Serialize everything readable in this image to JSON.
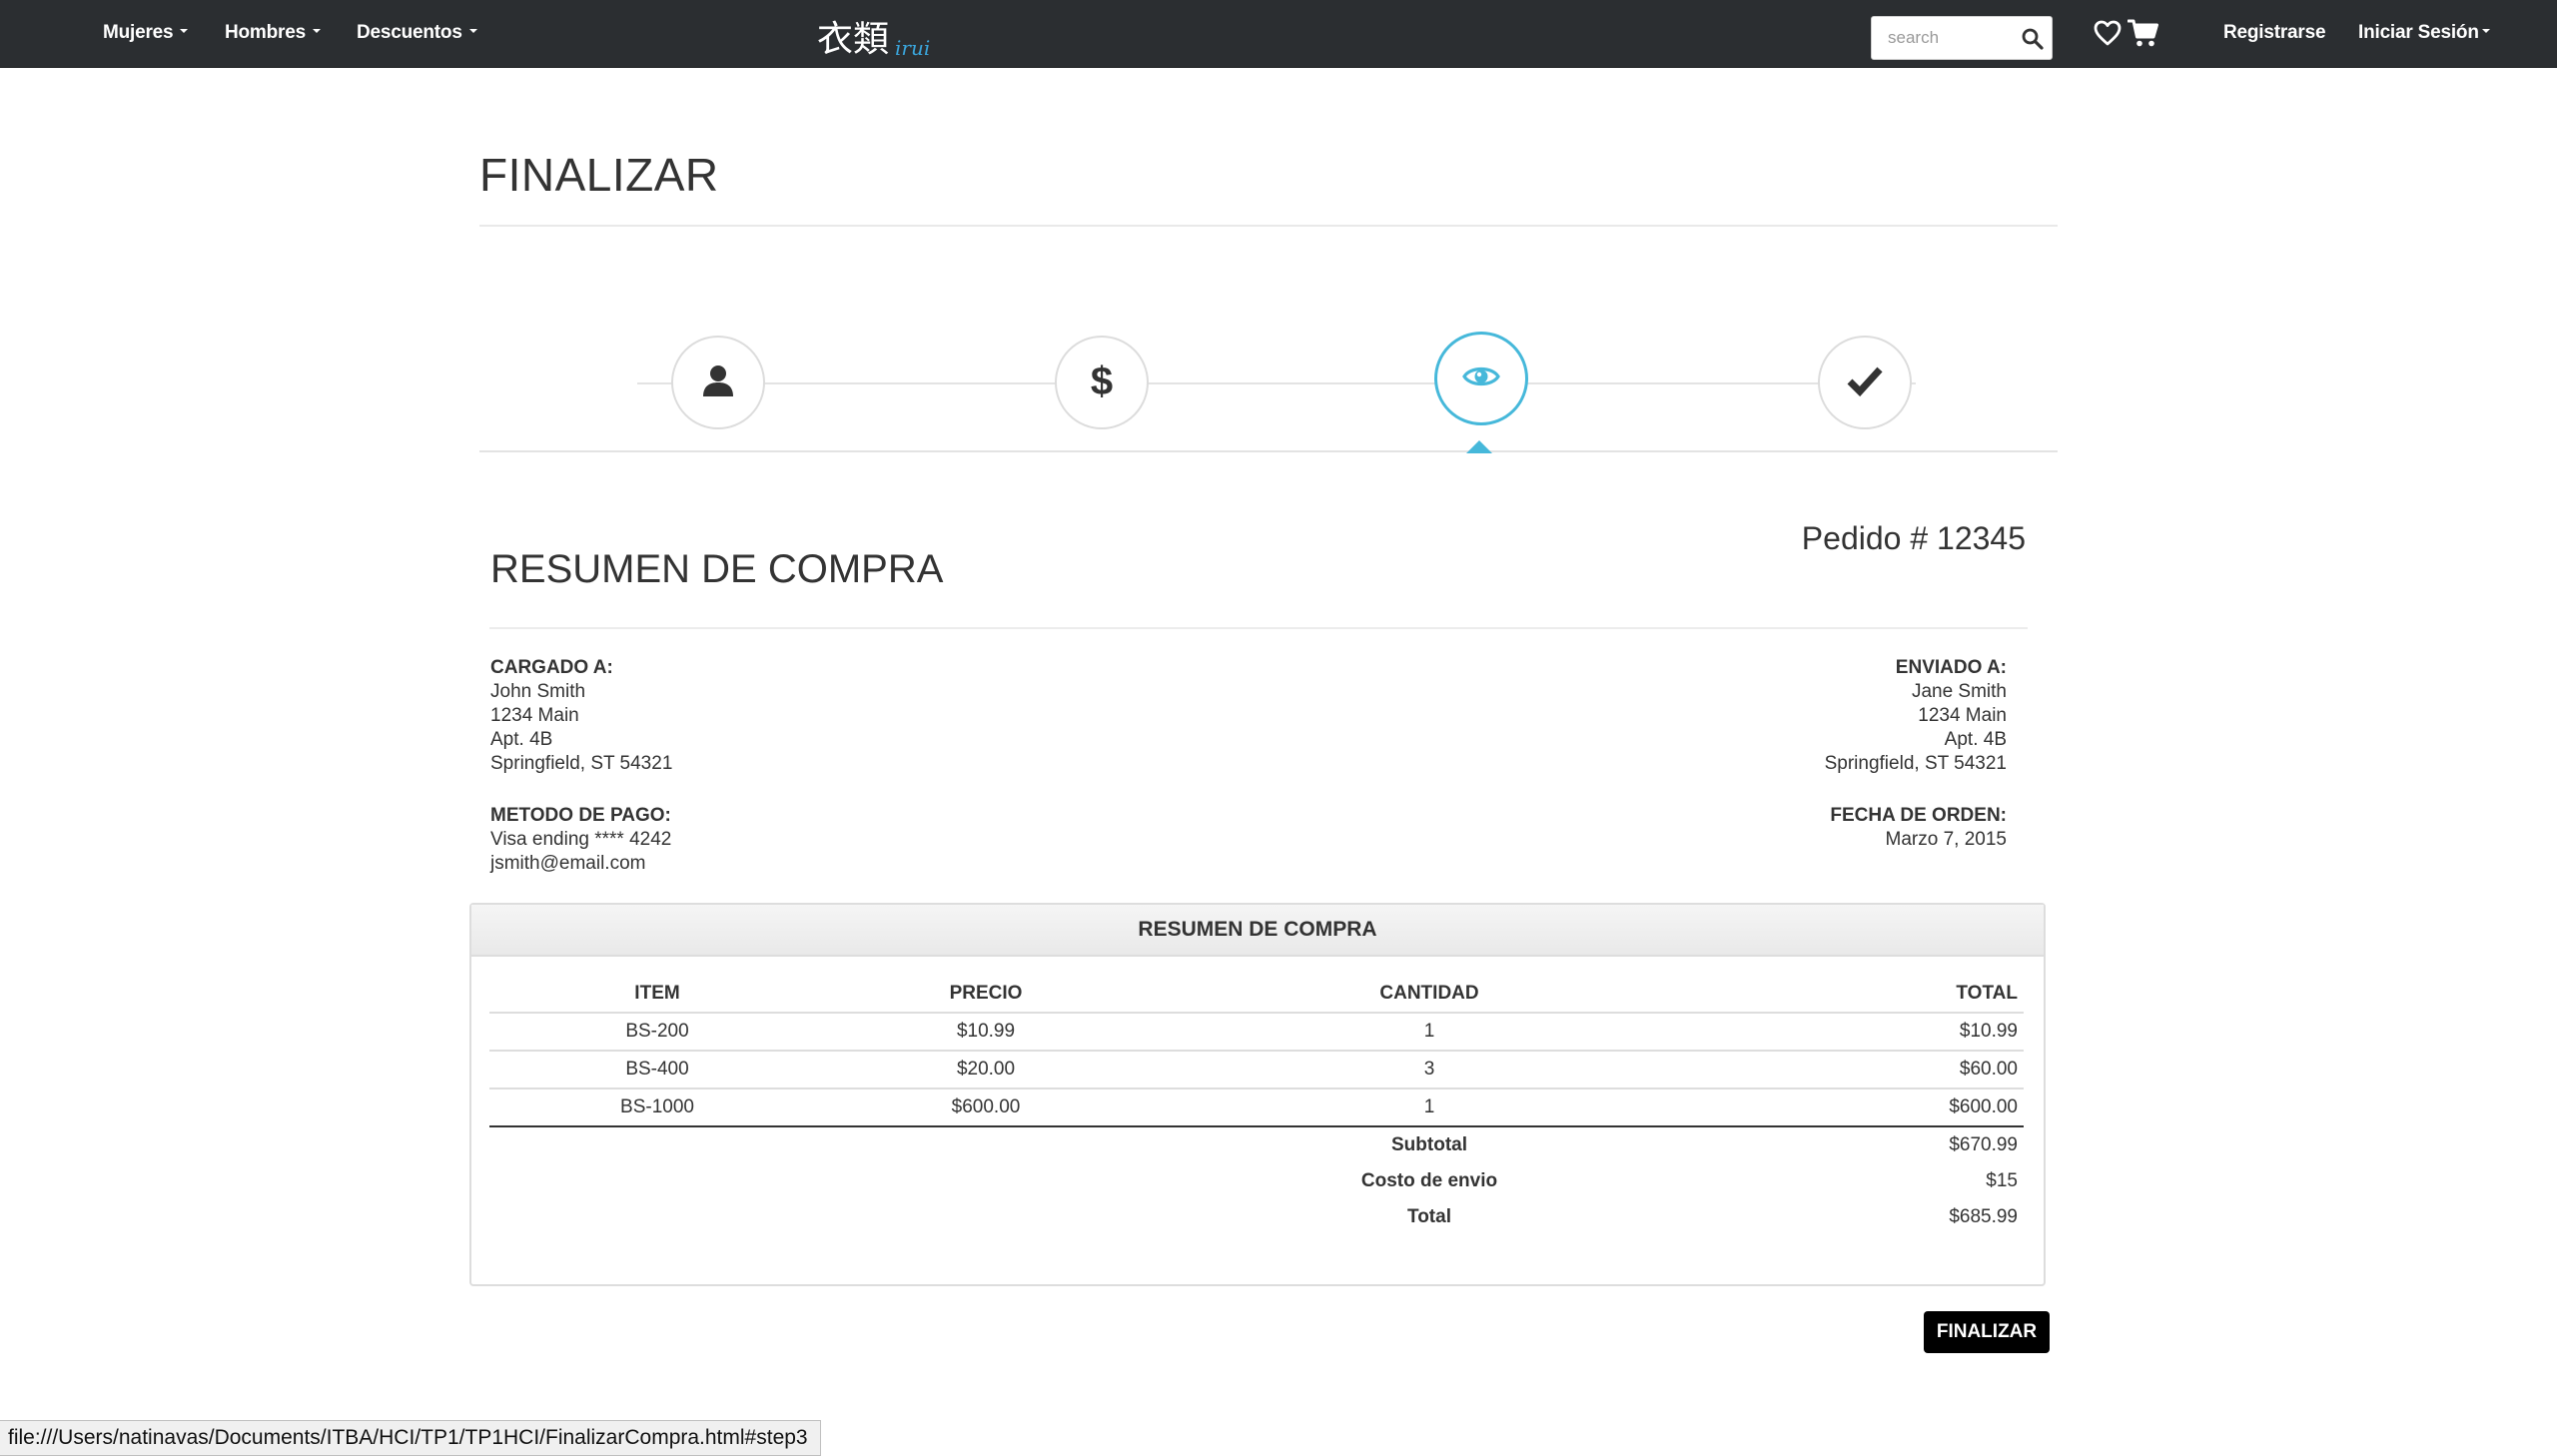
{
  "navbar": {
    "menu": [
      {
        "label": "Mujeres"
      },
      {
        "label": "Hombres"
      },
      {
        "label": "Descuentos"
      }
    ],
    "logo_kanji": "衣類",
    "logo_sub": "irui",
    "search_placeholder": "search",
    "register_label": "Registrarse",
    "login_label": "Iniciar Sesión"
  },
  "page": {
    "title": "FINALIZAR"
  },
  "steps": [
    {
      "icon": "user-icon",
      "active": false
    },
    {
      "icon": "dollar-icon",
      "active": false
    },
    {
      "icon": "eye-icon",
      "active": true
    },
    {
      "icon": "check-icon",
      "active": false
    }
  ],
  "summary": {
    "title": "RESUMEN DE COMPRA",
    "order_number": "Pedido # 12345",
    "billed_to": {
      "label": "CARGADO A:",
      "lines": [
        "John Smith",
        "1234 Main",
        "Apt. 4B",
        "Springfield, ST 54321"
      ]
    },
    "shipped_to": {
      "label": "ENVIADO A:",
      "lines": [
        "Jane Smith",
        "1234 Main",
        "Apt. 4B",
        "Springfield, ST 54321"
      ]
    },
    "payment": {
      "label": "METODO DE PAGO:",
      "lines": [
        "Visa ending **** 4242",
        "jsmith@email.com"
      ]
    },
    "order_date": {
      "label": "FECHA DE ORDEN:",
      "value": "Marzo 7, 2015"
    }
  },
  "table": {
    "panel_title": "RESUMEN DE COMPRA",
    "headers": {
      "item": "ITEM",
      "price": "PRECIO",
      "qty": "CANTIDAD",
      "total": "TOTAL"
    },
    "rows": [
      {
        "item": "BS-200",
        "price": "$10.99",
        "qty": "1",
        "total": "$10.99"
      },
      {
        "item": "BS-400",
        "price": "$20.00",
        "qty": "3",
        "total": "$60.00"
      },
      {
        "item": "BS-1000",
        "price": "$600.00",
        "qty": "1",
        "total": "$600.00"
      }
    ],
    "totals": [
      {
        "label": "Subtotal",
        "value": "$670.99"
      },
      {
        "label": "Costo de envio",
        "value": "$15"
      },
      {
        "label": "Total",
        "value": "$685.99"
      }
    ]
  },
  "actions": {
    "finalize_label": "FINALIZAR"
  },
  "statusbar": {
    "url": "file:///Users/natinavas/Documents/ITBA/HCI/TP1/TP1HCI/FinalizarCompra.html#step3"
  },
  "colors": {
    "navbar_bg": "#2b2e31",
    "accent": "#46b8da",
    "logo_accent": "#3aa6dd",
    "button_bg": "#000000"
  }
}
